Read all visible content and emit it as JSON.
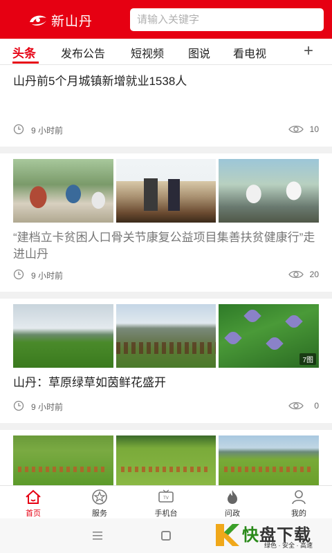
{
  "app": {
    "name": "新山丹",
    "brand_color": "#e60012"
  },
  "search": {
    "placeholder": "请输入关键字"
  },
  "tabs": [
    {
      "label": "头条",
      "active": true
    },
    {
      "label": "发布公告"
    },
    {
      "label": "短视频"
    },
    {
      "label": "图说"
    },
    {
      "label": "看电视"
    }
  ],
  "tabs_add_icon": "plus-icon",
  "articles": [
    {
      "title": "山丹前5个月城镇新增就业1538人",
      "time": "9 小时前",
      "views": "10"
    },
    {
      "title": "“建档立卡贫困人口骨关节康复公益项目集善扶贫健康行”走进山丹",
      "time": "9 小时前",
      "views": "20"
    },
    {
      "title": "山丹：草原绿草如茵鲜花盛开",
      "time": "9 小时前",
      "views": "0",
      "image_count": "7图"
    }
  ],
  "bottom_nav": [
    {
      "label": "首页",
      "icon": "home-icon",
      "active": true
    },
    {
      "label": "服务",
      "icon": "service-icon"
    },
    {
      "label": "手机台",
      "icon": "tv-icon"
    },
    {
      "label": "问政",
      "icon": "flame-icon"
    },
    {
      "label": "我的",
      "icon": "user-icon"
    }
  ],
  "watermark": {
    "main_left": "快",
    "main_right": "盘下载",
    "sub": "绿色 · 安全 · 高速"
  }
}
